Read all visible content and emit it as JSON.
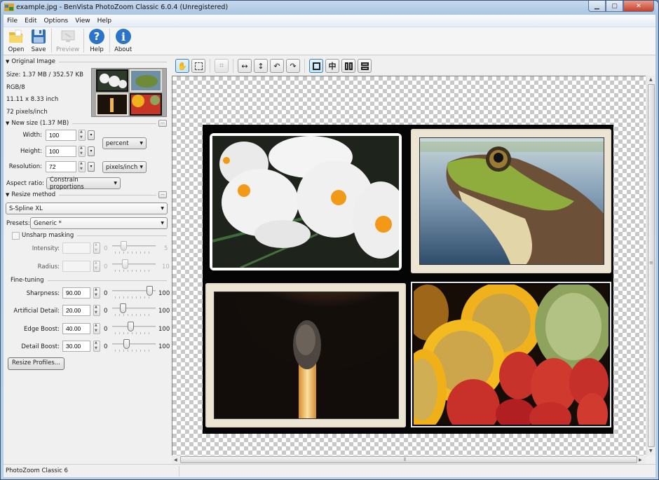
{
  "window": {
    "title": "example.jpg - BenVista PhotoZoom Classic 6.0.4 (Unregistered)",
    "controls": {
      "minimize": "▁",
      "maximize": "▢",
      "close": "✕"
    }
  },
  "menu": [
    "File",
    "Edit",
    "Options",
    "View",
    "Help"
  ],
  "toolbar": {
    "buttons": [
      {
        "label": "Open",
        "icon": "folder-open-icon",
        "enabled": true
      },
      {
        "label": "Save",
        "icon": "floppy-disk-icon",
        "enabled": true
      },
      {
        "label": "Preview",
        "icon": "preview-icon",
        "enabled": false
      },
      {
        "label": "Help",
        "icon": "help-icon",
        "enabled": true
      },
      {
        "label": "About",
        "icon": "info-icon",
        "enabled": true
      }
    ]
  },
  "original_image": {
    "heading": "Original Image",
    "size": "Size: 1.37 MB / 352.57 KB",
    "mode": "RGB/8",
    "dimensions": "11.11 x 8.33 inch",
    "resolution": "72 pixels/inch"
  },
  "new_size": {
    "heading": "New size (1.37 MB)",
    "more": "...",
    "width_label": "Width:",
    "width_value": "100",
    "height_label": "Height:",
    "height_value": "100",
    "size_unit": "percent",
    "resolution_label": "Resolution:",
    "resolution_value": "72",
    "resolution_unit": "pixels/inch",
    "aspect_label": "Aspect ratio:",
    "aspect_value": "Constrain proportions"
  },
  "resize_method": {
    "heading": "Resize method",
    "more": "...",
    "method": "S-Spline XL",
    "presets_label": "Presets:",
    "preset": "Generic *"
  },
  "unsharp": {
    "label": "Unsharp masking",
    "checked": false,
    "intensity_label": "Intensity:",
    "intensity_value": "",
    "intensity_min": "0",
    "intensity_max": "5",
    "intensity_fraction": 0.22,
    "radius_label": "Radius:",
    "radius_value": "",
    "radius_min": "0",
    "radius_max": "10",
    "radius_fraction": 0.25
  },
  "fine_tuning": {
    "heading": "Fine-tuning",
    "params": [
      {
        "label": "Sharpness:",
        "value": "90.00",
        "min": "0",
        "max": "100",
        "fraction": 0.9
      },
      {
        "label": "Artificial Detail:",
        "value": "20.00",
        "min": "0",
        "max": "100",
        "fraction": 0.2
      },
      {
        "label": "Edge Boost:",
        "value": "40.00",
        "min": "0",
        "max": "100",
        "fraction": 0.4
      },
      {
        "label": "Detail Boost:",
        "value": "30.00",
        "min": "0",
        "max": "100",
        "fraction": 0.3
      }
    ],
    "profiles_button": "Resize Profiles..."
  },
  "view_toolbar": {
    "tools": [
      "hand-tool",
      "selection-tool",
      "crop-tool",
      "fit-width",
      "fit-height",
      "rotate-left",
      "rotate-right",
      "single-view",
      "split-view",
      "side-by-side-view",
      "stacked-view"
    ],
    "active": [
      "hand-tool",
      "single-view"
    ],
    "disabled": [
      "crop-tool"
    ]
  },
  "canvas": {
    "photos": [
      "white crocus flowers",
      "green frog",
      "burning match",
      "yellow fruit and strawberries"
    ]
  },
  "status": {
    "text": "PhotoZoom Classic 6"
  }
}
